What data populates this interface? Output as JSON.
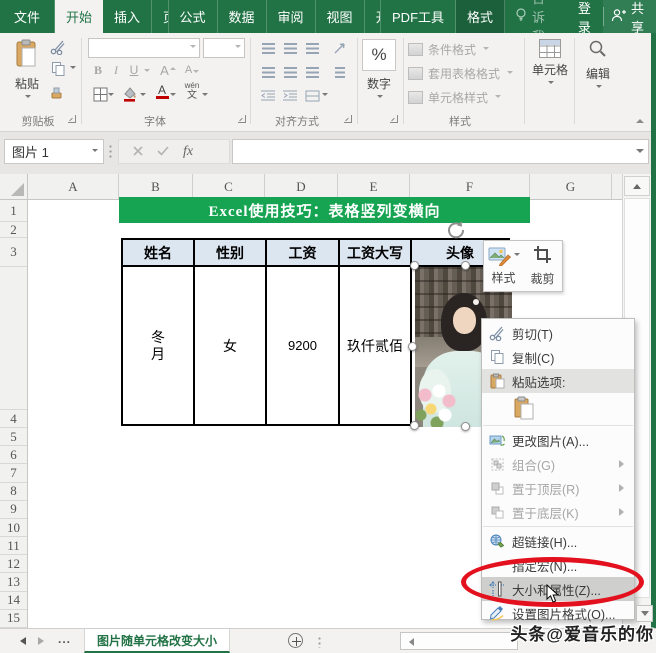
{
  "app": {
    "tabs": [
      "文件",
      "开始",
      "插入",
      "页面布局",
      "公式",
      "数据",
      "审阅",
      "视图",
      "开发工具",
      "PDF工具",
      "格式"
    ],
    "tell_me": "告诉我...",
    "sign_in": "登录",
    "share": "共享"
  },
  "ribbon": {
    "clipboard": {
      "group_label": "剪贴板",
      "paste_label": "粘贴"
    },
    "font": {
      "group_label": "字体",
      "bold": "B",
      "italic": "I",
      "underline": "U",
      "grow": "A",
      "shrink": "A",
      "color_letter": "A",
      "phonetic_top": "wén",
      "phonetic_bottom": "文"
    },
    "alignment": {
      "group_label": "对齐方式"
    },
    "number": {
      "percent": "%",
      "number_label": "数字"
    },
    "styles": {
      "group_label": "样式",
      "conditional": "条件格式",
      "format_table": "套用表格格式",
      "cell_styles": "单元格样式"
    },
    "cells": {
      "group_label": "单元格"
    },
    "editing": {
      "group_label": "编辑"
    }
  },
  "formula_bar": {
    "name_box": "图片 1",
    "fx": "fx",
    "value": ""
  },
  "grid": {
    "column_letters": [
      "A",
      "B",
      "C",
      "D",
      "E",
      "F",
      "G"
    ],
    "row_numbers_top": [
      "1",
      "2",
      "3"
    ],
    "row_numbers_bottom": [
      "4",
      "5",
      "6",
      "7",
      "8",
      "9",
      "10",
      "11",
      "12",
      "13",
      "14",
      "15"
    ]
  },
  "sheet": {
    "banner": "Excel使用技巧：表格竖列变横向",
    "table": {
      "headers": [
        "姓名",
        "性别",
        "工资",
        "工资大写",
        "头像"
      ],
      "row": {
        "name_line1": "冬",
        "name_line2": "月",
        "gender": "女",
        "salary": "9200",
        "salary_caps": "玖仟贰佰"
      }
    }
  },
  "mini_toolbar": {
    "style": "样式",
    "crop": "裁剪"
  },
  "context_menu": {
    "items": [
      {
        "label": "剪切(T)"
      },
      {
        "label": "复制(C)"
      },
      {
        "label": "粘贴选项:"
      },
      {
        "label": "更改图片(A)..."
      },
      {
        "label": "组合(G)"
      },
      {
        "label": "置于顶层(R)"
      },
      {
        "label": "置于底层(K)"
      },
      {
        "label": "超链接(H)..."
      },
      {
        "label": "指定宏(N)..."
      },
      {
        "label": "大小和属性(Z)..."
      },
      {
        "label": "设置图片格式(O)..."
      }
    ]
  },
  "sheet_bar": {
    "overflow": "...",
    "tab": "图片随单元格改变大小"
  },
  "watermark": "头条@爱音乐的你",
  "colors": {
    "excel_green": "#217346",
    "banner_green": "#16a452",
    "table_header_blue": "#dce6f1",
    "annotation_red": "#e3101d",
    "menu_highlight": "#cfcfcd"
  }
}
